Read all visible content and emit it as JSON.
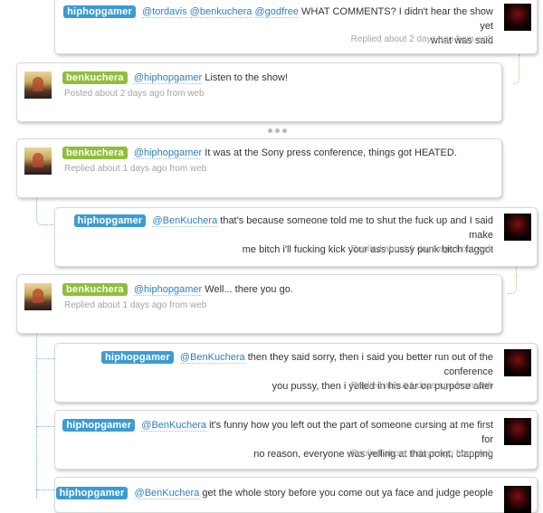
{
  "tweets": [
    {
      "user": "hiphopgamer",
      "mentions": [
        "@tordavis",
        "@benkuchera",
        "@godfree"
      ],
      "text_line1": "WHAT COMMENTS? I didn't hear the show yet",
      "text_line2": "what was said",
      "meta": "Replied about 2 days ago from web"
    },
    {
      "user": "benkuchera",
      "mention": "@hiphopgamer",
      "text_line1": "Listen to the show!",
      "meta": "Posted about 2 days ago from web"
    },
    {
      "user": "benkuchera",
      "mention": "@hiphopgamer",
      "text_line1": "It was at the Sony press conference, things got HEATED.",
      "meta": "Replied about 1 days ago from web"
    },
    {
      "user": "hiphopgamer",
      "mention": "@BenKuchera",
      "text_line1": "that's because someone told me to shut the fuck up and I said make",
      "text_line2": "me bitch i'll fucking kick your ass pussy punk bitch faggot",
      "meta": "Replied about 1 days ago from web"
    },
    {
      "user": "benkuchera",
      "mention": "@hiphopgamer",
      "text_line1": "Well... there you go.",
      "meta": "Replied about 1 days ago from web"
    },
    {
      "user": "hiphopgamer",
      "mention": "@BenKuchera",
      "text_line1": "then they said sorry, then i said you better run out of the conference",
      "text_line2": "you pussy, then i yelled in his ear on purpose after",
      "meta": "Replied about 1 days ago from web"
    },
    {
      "user": "hiphopgamer",
      "mention": "@BenKuchera",
      "text_line1": "it's funny how you left out the part of someone cursing at me first for",
      "text_line2": "no reason, everyone was yelling at that point, clapping",
      "meta": "Replied about 1 days ago from web"
    },
    {
      "user": "hiphopgamer",
      "mention": "@BenKuchera",
      "text_line1": "get the whole story before you come out ya face and judge people"
    }
  ],
  "colors": {
    "hiphopgamer_badge": "#3d9bd3",
    "benkuchera_badge": "#8fbf3a",
    "mention_link": "#2f7fbe",
    "meta_text": "#a4a4a4"
  },
  "icons": {
    "more": "ellipsis-icon",
    "hiphopgamer_avatar": "avatar-dark-red",
    "benkuchera_avatar": "avatar-photo"
  }
}
